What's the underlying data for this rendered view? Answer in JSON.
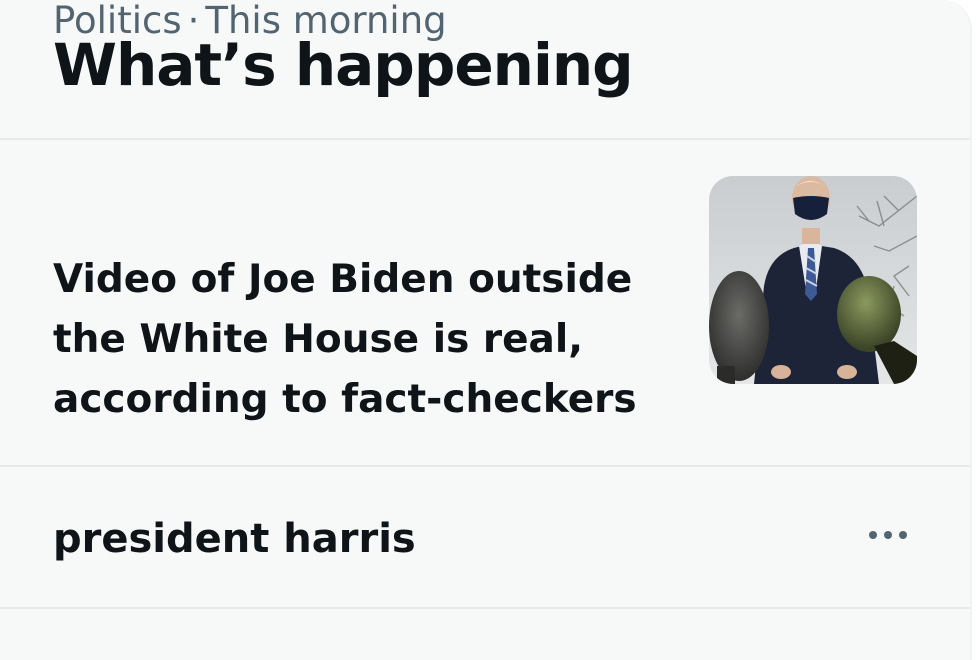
{
  "panel": {
    "title": "What’s happening"
  },
  "trend_card": {
    "category": "Politics",
    "separator": "·",
    "time": "This morning",
    "headline": "Video of Joe Biden outside the White House is real, according to fact-checkers"
  },
  "trend_row": {
    "name": "president harris"
  },
  "icons": {
    "more": "more-horizontal-icon"
  },
  "colors": {
    "panel_bg": "#f7f9f9",
    "text_primary": "#0f1419",
    "text_secondary": "#536471",
    "divider": "#e7eaeb"
  }
}
